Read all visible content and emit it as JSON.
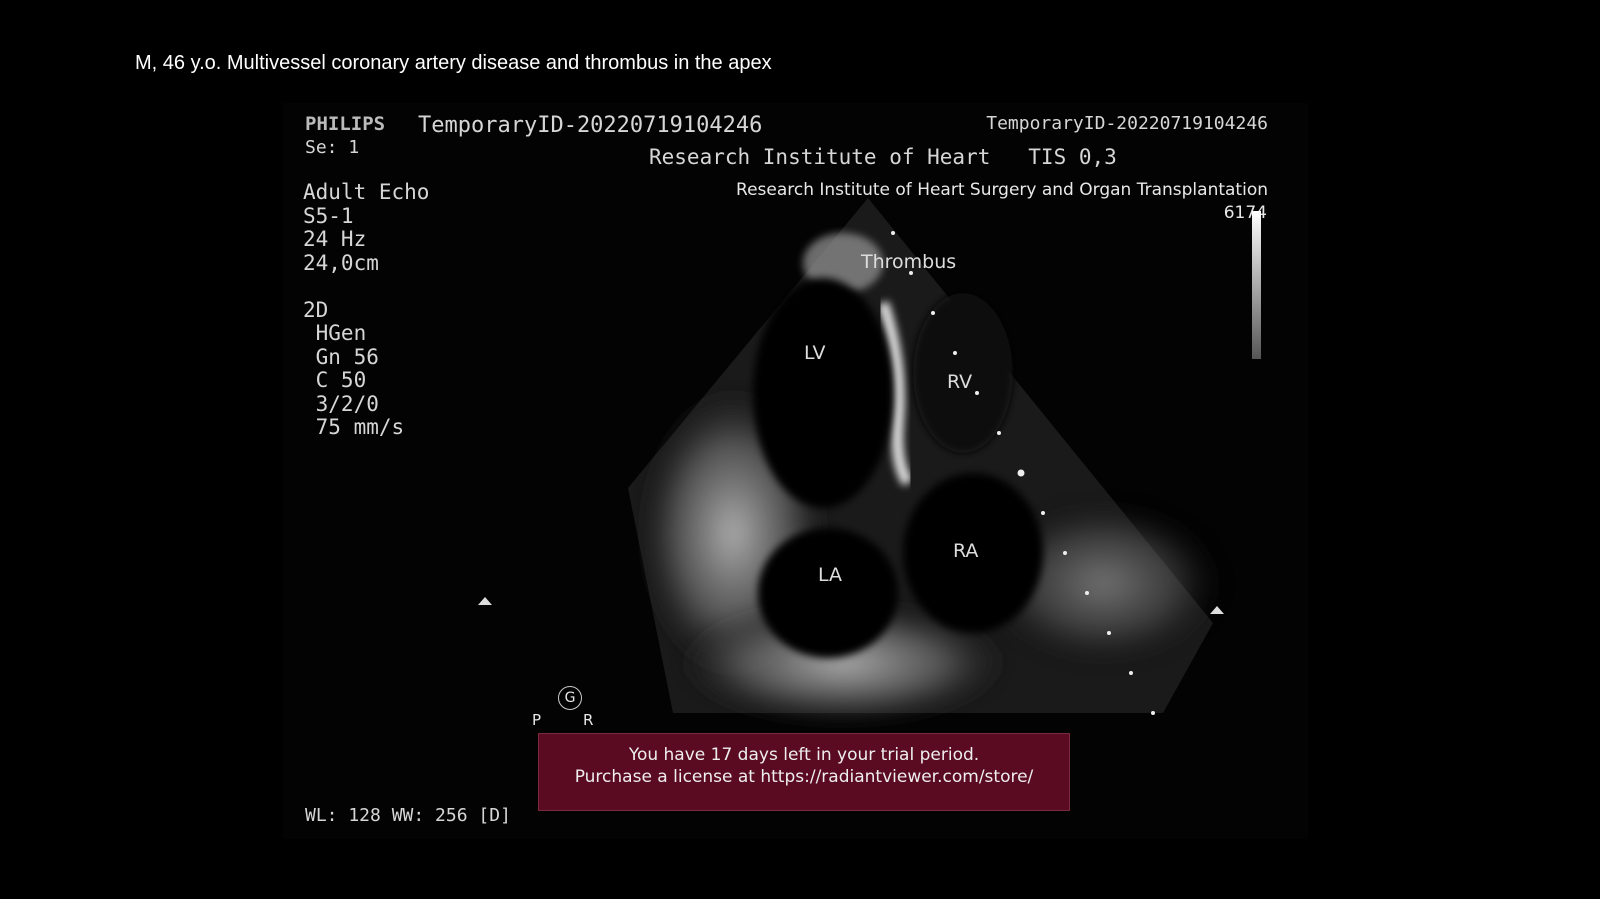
{
  "caption": "M, 46 y.o. Multivessel coronary artery disease and thrombus in the apex",
  "overlay": {
    "brand": "PHILIPS",
    "patient_id": "TemporaryID-20220719104246",
    "series": "Se: 1",
    "params": [
      "Adult Echo",
      "S5-1",
      "24 Hz",
      "24,0cm",
      "",
      "2D",
      " HGen",
      " Gn 56",
      " C 50",
      " 3/2/0",
      " 75 mm/s"
    ],
    "right_id": "TemporaryID-20220719104246",
    "institute_short": "Research Institute of Heart   TIS 0,3",
    "institute_full": "Research Institute of Heart Surgery and Organ Transplantation",
    "number": "6174",
    "wl_ww": "WL: 128 WW: 256 [D]",
    "orientation": {
      "g": "G",
      "p": "P",
      "r": "R"
    }
  },
  "labels": {
    "thrombus": "Thrombus",
    "lv": "LV",
    "rv": "RV",
    "la": "LA",
    "ra": "RA"
  },
  "trial_banner": {
    "line1": "You have 17 days left in your trial period.",
    "line2": "Purchase a license at https://radiantviewer.com/store/"
  }
}
